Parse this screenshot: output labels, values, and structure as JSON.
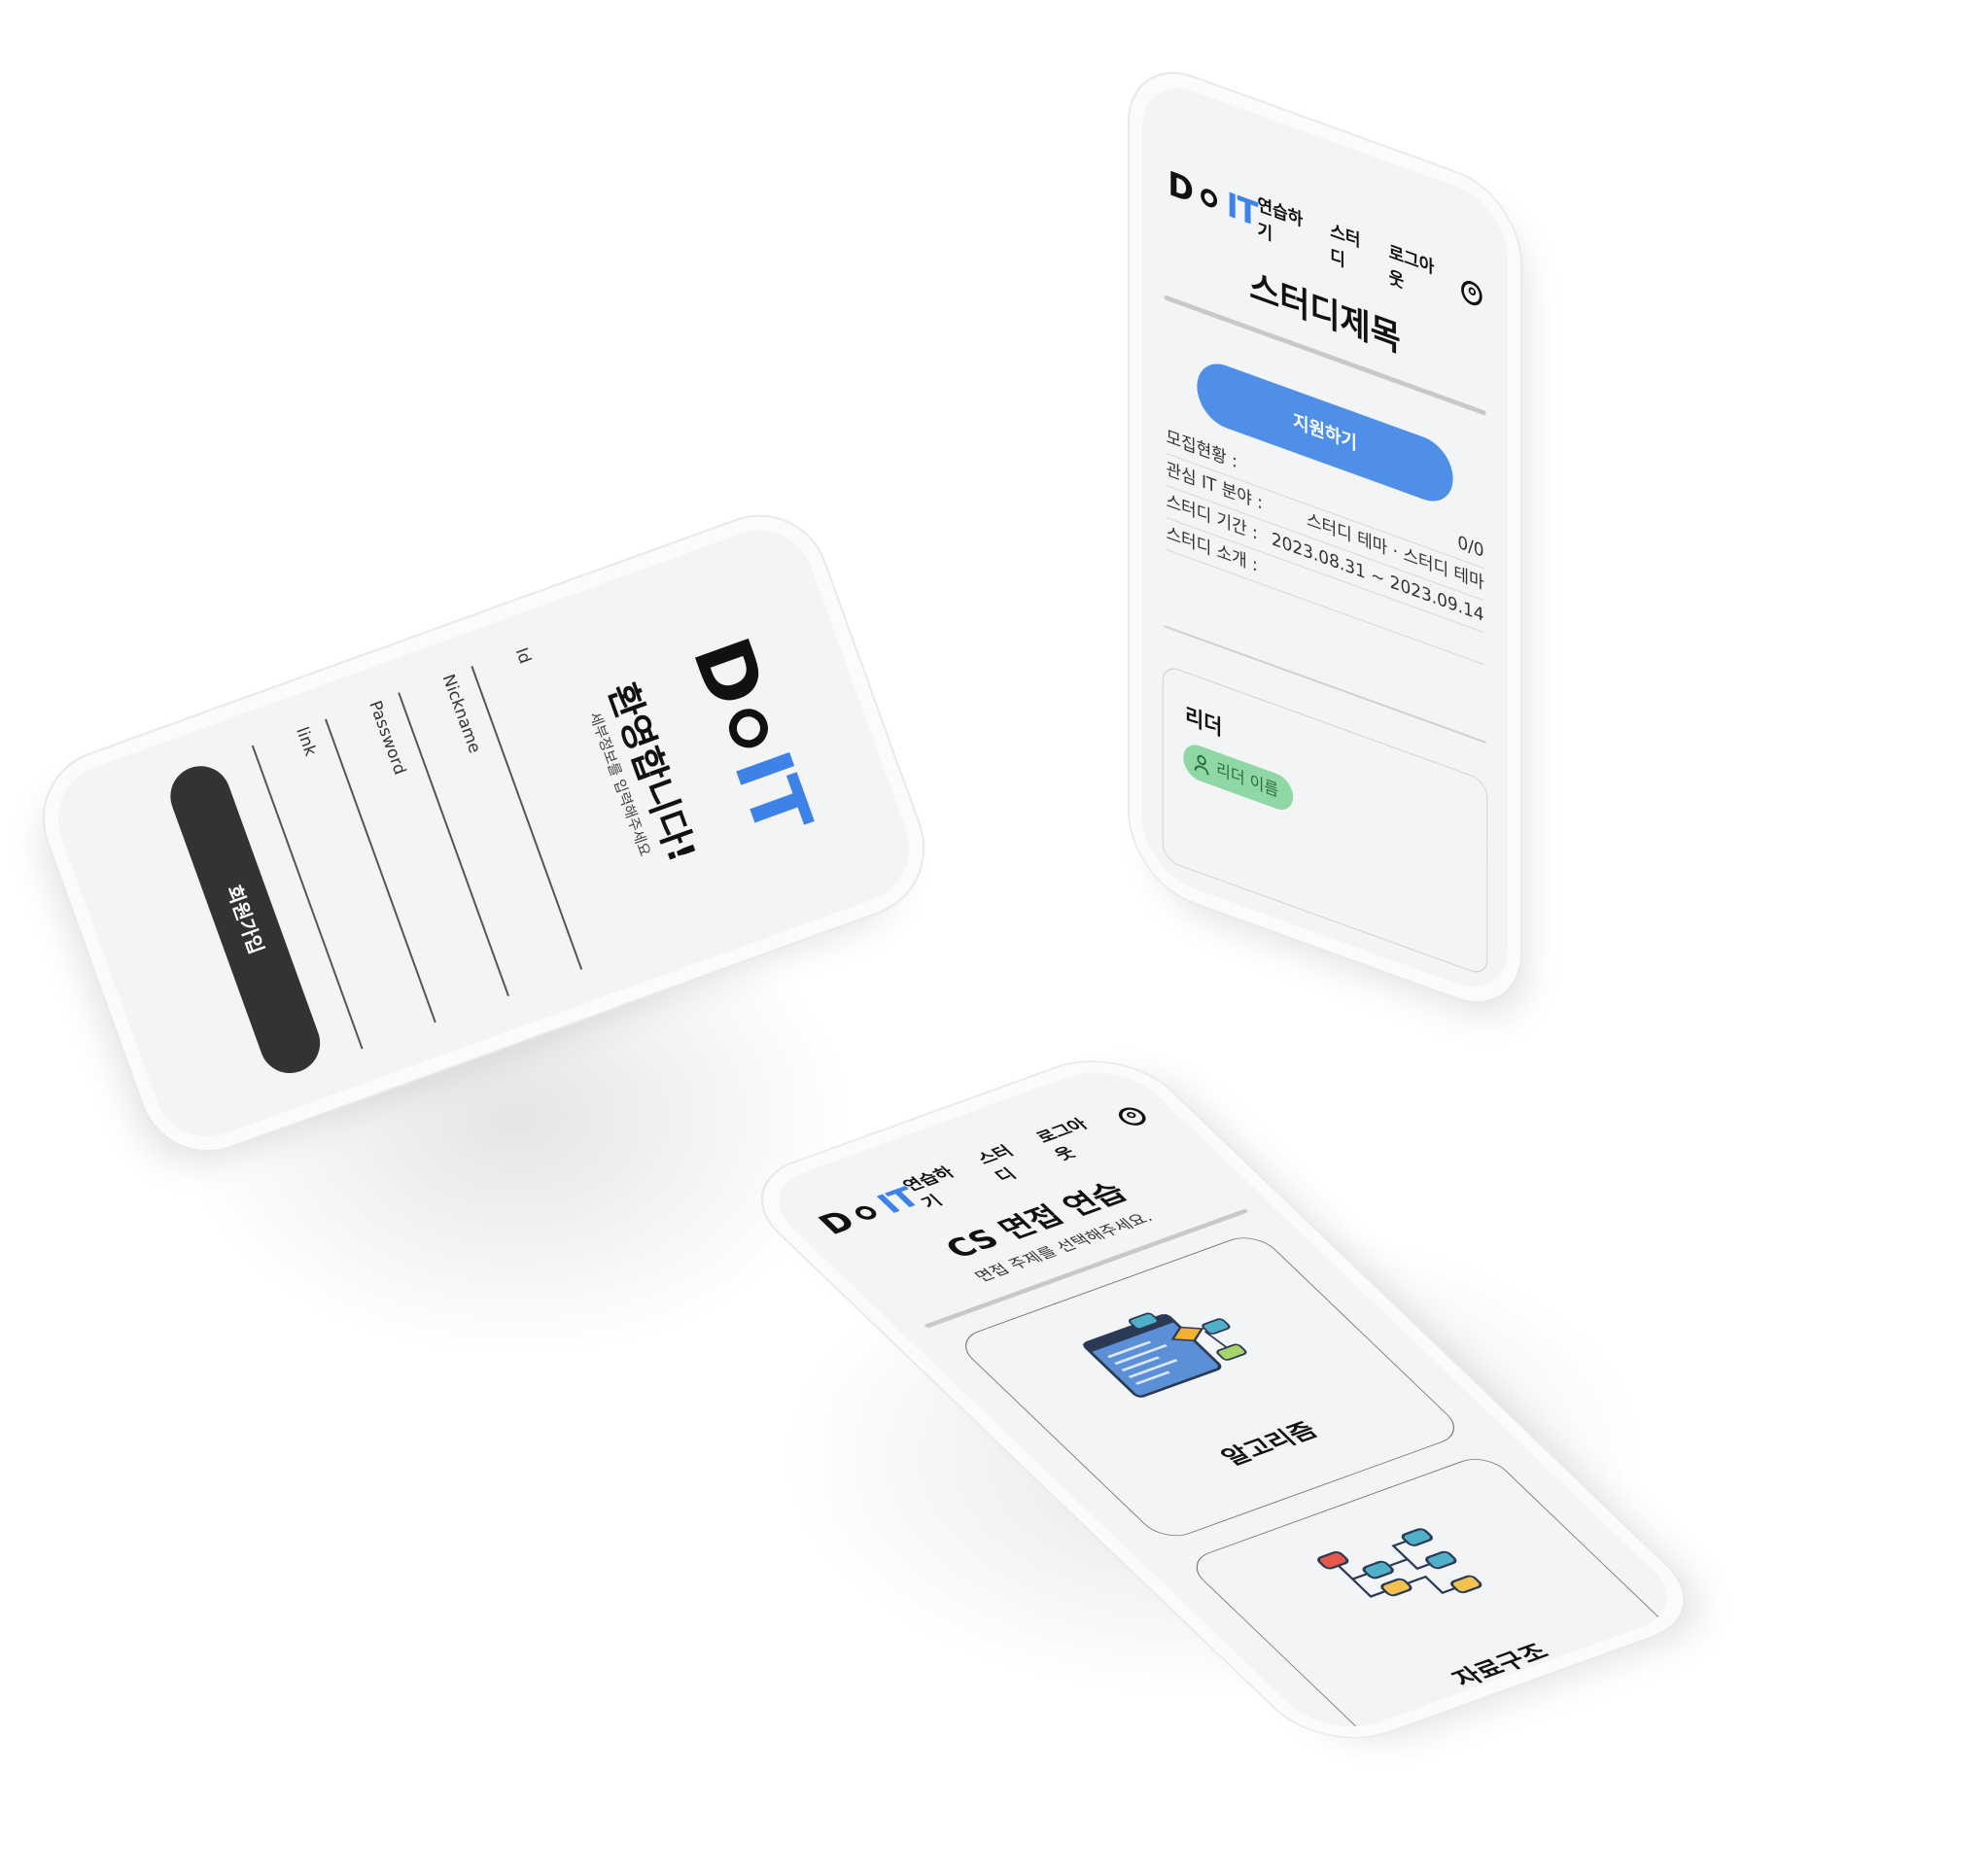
{
  "logo": {
    "d": "D",
    "it": "IT"
  },
  "nav": {
    "practice": "연습하기",
    "study": "스터디",
    "logout": "로그아웃"
  },
  "study_detail": {
    "title": "스터디제목",
    "apply_button": "지원하기",
    "info": [
      {
        "label": "모집현황 :",
        "value": "0/0"
      },
      {
        "label": "관심 IT 분야 :",
        "value": "스터디 테마 · 스터디 테마"
      },
      {
        "label": "스터디 기간 :",
        "value": "2023.08.31 ~ 2023.09.14"
      },
      {
        "label": "스터디 소개 :",
        "value": ""
      }
    ],
    "leader_title": "리더",
    "leader_name": "리더 이름",
    "leader_badge_color": "#8fd7a4"
  },
  "signup": {
    "welcome": "환영합니다!",
    "subtitle": "세부정보를 입력해주세요",
    "fields": [
      {
        "label": "Id"
      },
      {
        "label": "Nickname"
      },
      {
        "label": "Password"
      },
      {
        "label": "link"
      }
    ],
    "submit_button": "회원가입"
  },
  "cs_practice": {
    "title": "CS 면접 연습",
    "subtitle": "면접 주제를 선택해주세요.",
    "cards": [
      {
        "label": "알고리즘",
        "icon": "algorithm-icon"
      },
      {
        "label": "자료구조",
        "icon": "data-structure-icon"
      }
    ]
  },
  "colors": {
    "accent": "#4f8fe8",
    "logo_blue": "#3d82e6",
    "dark_button": "#333333"
  }
}
